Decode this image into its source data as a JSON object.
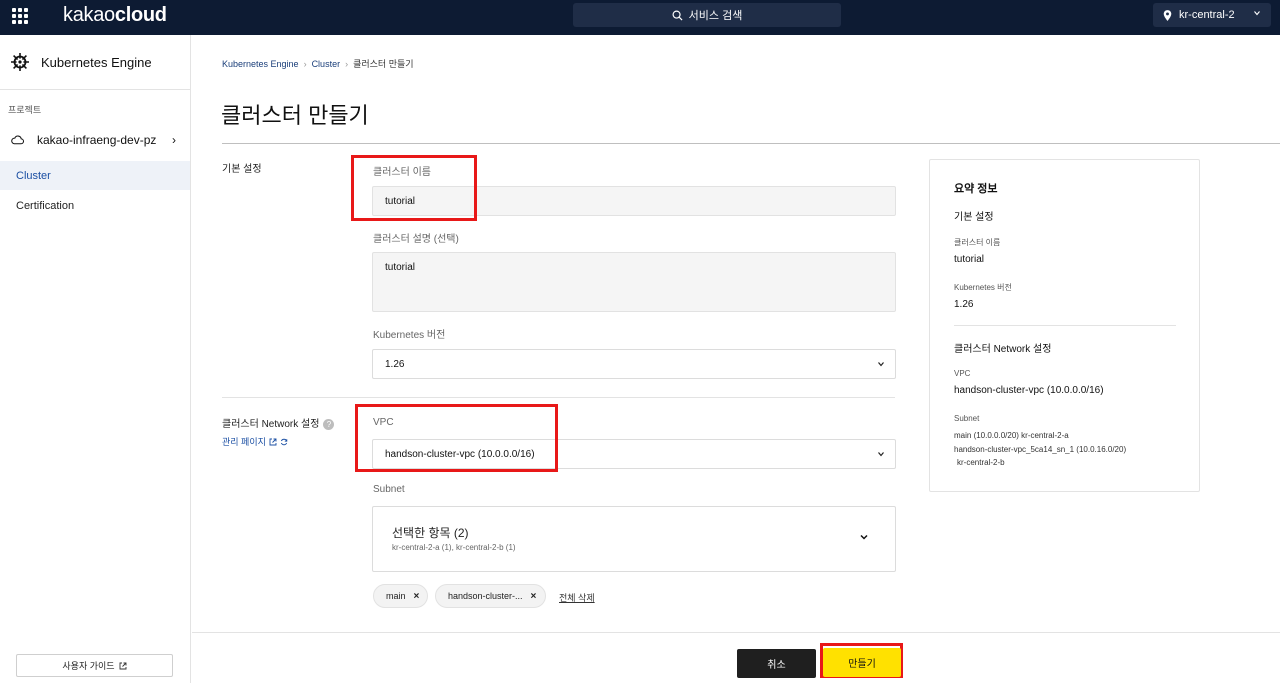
{
  "topbar": {
    "logo_light": "kakao",
    "logo_bold": "cloud",
    "search_label": "서비스 검색",
    "region": "kr-central-2"
  },
  "sidebar": {
    "service_title": "Kubernetes Engine",
    "project_label": "프로젝트",
    "project_name": "kakao-infraeng-dev-pz",
    "items": [
      {
        "label": "Cluster"
      },
      {
        "label": "Certification"
      }
    ],
    "guide_label": "사용자 가이드"
  },
  "breadcrumb": [
    "Kubernetes Engine",
    "Cluster",
    "클러스터 만들기"
  ],
  "page_title": "클러스터 만들기",
  "basic": {
    "section_label": "기본 설정",
    "name_label": "클러스터 이름",
    "name_value": "tutorial",
    "desc_label": "클러스터 설명 (선택)",
    "desc_value": "tutorial",
    "version_label": "Kubernetes 버전",
    "version_value": "1.26"
  },
  "network": {
    "section_label": "클러스터 Network 설정",
    "help": "?",
    "manage_link": "관리 페이지",
    "vpc_label": "VPC",
    "vpc_value": "handson-cluster-vpc (10.0.0.0/16)",
    "subnet_label": "Subnet",
    "subnet_title": "선택한 항목 (2)",
    "subnet_sub": "kr-central-2-a (1), kr-central-2-b (1)",
    "chips": [
      "main",
      "handson-cluster-..."
    ],
    "chip_remove": "×",
    "clear_all": "전체 삭제"
  },
  "summary": {
    "title": "요약 정보",
    "basic_section": "기본 설정",
    "name_label": "클러스터 이름",
    "name_value": "tutorial",
    "version_label": "Kubernetes 버전",
    "version_value": "1.26",
    "network_section": "클러스터 Network 설정",
    "vpc_label": "VPC",
    "vpc_value": "handson-cluster-vpc (10.0.0.0/16)",
    "subnet_label": "Subnet",
    "subnet_line1": "main (10.0.0.0/20)  kr-central-2-a",
    "subnet_line2": "handson-cluster-vpc_5ca14_sn_1 (10.0.16.0/20)",
    "subnet_line3": "kr-central-2-b"
  },
  "footer": {
    "cancel_label": "취소",
    "create_label": "만들기"
  },
  "colors": {
    "topbar": "#0d1b33",
    "primary_button": "#ffe100",
    "highlight": "#e81818",
    "active_nav": "#1b4fa3"
  }
}
